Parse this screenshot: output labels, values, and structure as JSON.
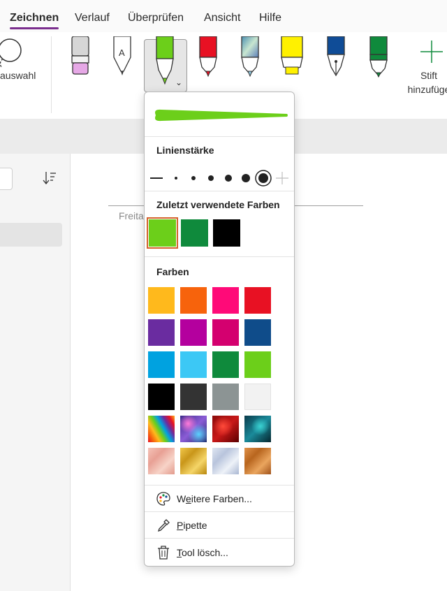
{
  "menubar": {
    "items": [
      {
        "label": "Zeichnen",
        "active": true
      },
      {
        "label": "Verlauf"
      },
      {
        "label": "Überprüfen"
      },
      {
        "label": "Ansicht"
      },
      {
        "label": "Hilfe"
      }
    ],
    "accent_color": "#7a2e8e"
  },
  "ribbon": {
    "lasso_label": "auswahl",
    "pens": [
      {
        "name": "eraser",
        "color": "#e6a8e6"
      },
      {
        "name": "text-pen",
        "color": "#ffffff"
      },
      {
        "name": "green-pen",
        "color": "#6ccf1a",
        "selected": true
      },
      {
        "name": "red-pen",
        "color": "#e81123"
      },
      {
        "name": "galaxy-pen",
        "color": "#8fc8e0"
      },
      {
        "name": "yellow-highlighter",
        "color": "#fff100"
      },
      {
        "name": "blue-fountain-pen",
        "color": "#0f4c97"
      },
      {
        "name": "dark-green-marker",
        "color": "#0f8a3c"
      }
    ],
    "add_pen_label_1": "Stift",
    "add_pen_label_2": "hinzufüge"
  },
  "canvas": {
    "date_label": "Freita"
  },
  "popup": {
    "preview_color": "#6ccf1a",
    "line_width_title": "Linienstärke",
    "recent_title": "Zuletzt verwendete Farben",
    "recent_colors": [
      "#6ccf1a",
      "#0f8a3c",
      "#000000"
    ],
    "colors_title": "Farben",
    "colors": [
      "#ffb91c",
      "#f7630c",
      "#ff0a78",
      "#e81123",
      "#6a2ca0",
      "#b4009e",
      "#d4006f",
      "#0f4c8a",
      "#00a2e0",
      "#3cc8f5",
      "#0f8a3c",
      "#6ccf1a",
      "#000000",
      "#333333",
      "#8c9494",
      "#f2f2f2"
    ],
    "textures": [
      "rainbow",
      "galaxy",
      "lava",
      "ocean",
      "rose-gold",
      "gold",
      "silver",
      "bronze"
    ],
    "more_colors_label_pre": "W",
    "more_colors_label_u": "e",
    "more_colors_label_post": "itere Farben...",
    "eyedropper_label_u": "P",
    "eyedropper_label_post": "ipette",
    "delete_tool_label_u": "T",
    "delete_tool_label_post": "ool lösch..."
  }
}
